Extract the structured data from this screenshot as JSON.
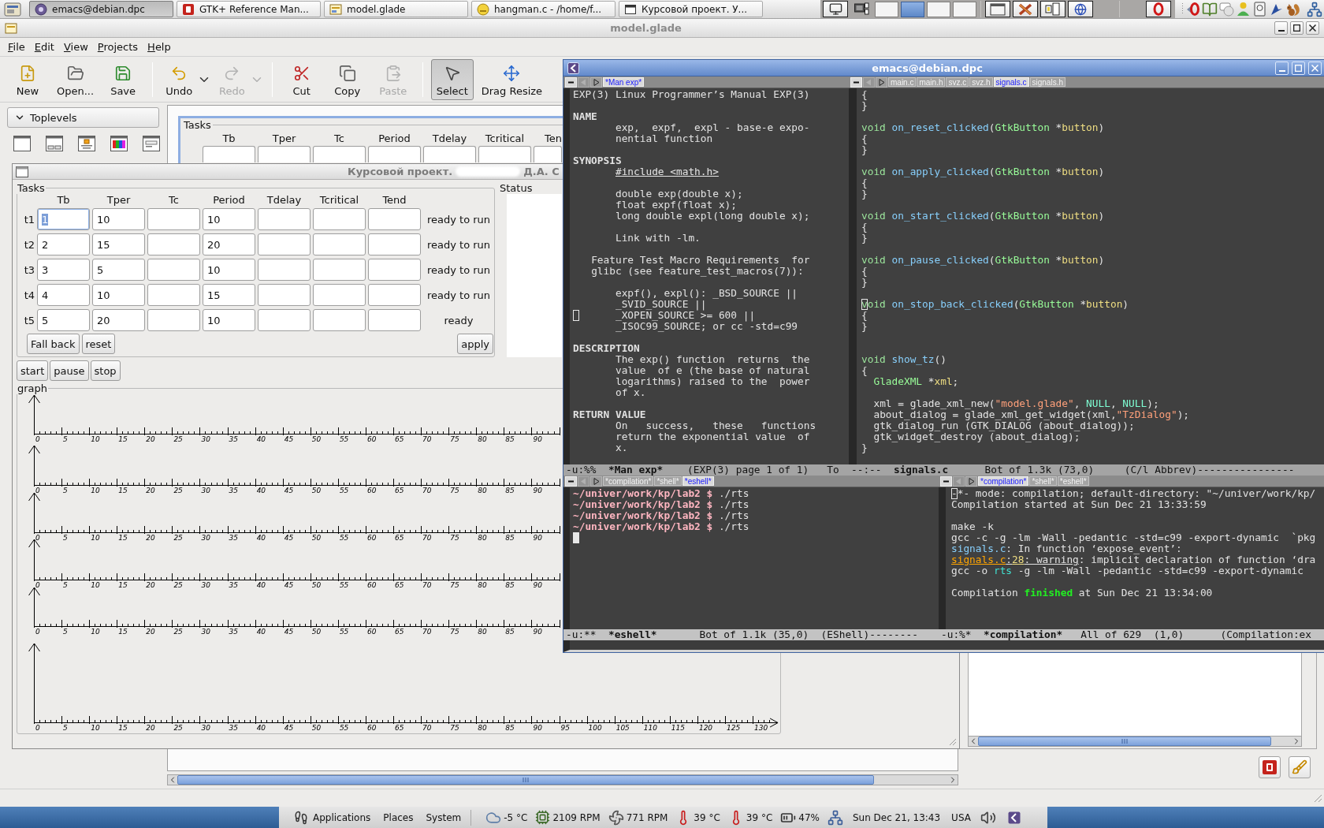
{
  "top_panel": {
    "tasks": [
      {
        "kind": "app",
        "label": "emacs@debian.dpc",
        "selected": true
      },
      {
        "kind": "book",
        "label": "GTK+ Reference Man...",
        "selected": false
      },
      {
        "kind": "designer",
        "label": "model.glade",
        "selected": false
      },
      {
        "kind": "editor",
        "label": "hangman.c - /home/f...",
        "selected": false
      },
      {
        "kind": "window",
        "label": "Курсовой проект. У...",
        "selected": false
      }
    ],
    "workspaces": [
      {
        "selected": false
      },
      {
        "selected": true
      },
      {
        "selected": false
      },
      {
        "selected": false
      }
    ]
  },
  "glade": {
    "title": "model.glade",
    "menu": [
      "File",
      "Edit",
      "View",
      "Projects",
      "Help"
    ],
    "toolbar": [
      [
        {
          "kind": "new",
          "label": "New",
          "disabled": false,
          "selected": false,
          "dropdown": false
        },
        {
          "kind": "open",
          "label": "Open...",
          "disabled": false,
          "selected": false,
          "dropdown": false
        },
        {
          "kind": "save",
          "label": "Save",
          "disabled": false,
          "selected": false,
          "dropdown": false
        }
      ],
      [
        {
          "kind": "undo",
          "label": "Undo",
          "disabled": false,
          "selected": false,
          "dropdown": true
        },
        {
          "kind": "redo",
          "label": "Redo",
          "disabled": true,
          "selected": false,
          "dropdown": true
        }
      ],
      [
        {
          "kind": "cut",
          "label": "Cut",
          "disabled": false,
          "selected": false,
          "dropdown": false
        },
        {
          "kind": "copy",
          "label": "Copy",
          "disabled": false,
          "selected": false,
          "dropdown": false
        },
        {
          "kind": "paste",
          "label": "Paste",
          "disabled": true,
          "selected": false,
          "dropdown": false
        }
      ],
      [
        {
          "kind": "select",
          "label": "Select",
          "disabled": false,
          "selected": true,
          "dropdown": false
        },
        {
          "kind": "drag_resize",
          "label": "Drag Resize",
          "disabled": false,
          "selected": false,
          "dropdown": false
        }
      ]
    ],
    "palette": {
      "group": "Toplevels",
      "expanded": true
    },
    "design_preview": {
      "frame_title": "Tasks",
      "columns": [
        "Tb",
        "Tper",
        "Tc",
        "Period",
        "Tdelay",
        "Tcritical",
        "Ten"
      ]
    }
  },
  "dialog": {
    "title": "Курсовой проект.",
    "title_tail": "Д.А. С",
    "tasks": {
      "title": "Tasks",
      "columns": [
        "Tb",
        "Tper",
        "Tc",
        "Period",
        "Tdelay",
        "Tcritical",
        "Tend"
      ],
      "rows": [
        {
          "label": "t1",
          "cells": [
            {
              "value": "1",
              "selected": true
            },
            {
              "value": "10",
              "selected": false
            },
            {
              "selected": false
            },
            {
              "value": "10",
              "selected": false
            },
            {
              "selected": false
            },
            {
              "selected": false
            },
            {
              "selected": false
            }
          ],
          "status": "ready to run"
        },
        {
          "label": "t2",
          "cells": [
            {
              "value": "2",
              "selected": false
            },
            {
              "value": "15",
              "selected": false
            },
            {
              "selected": false
            },
            {
              "value": "20",
              "selected": false
            },
            {
              "selected": false
            },
            {
              "selected": false
            },
            {
              "selected": false
            }
          ],
          "status": "ready to run"
        },
        {
          "label": "t3",
          "cells": [
            {
              "value": "3",
              "selected": false
            },
            {
              "value": "5",
              "selected": false
            },
            {
              "selected": false
            },
            {
              "value": "10",
              "selected": false
            },
            {
              "selected": false
            },
            {
              "selected": false
            },
            {
              "selected": false
            }
          ],
          "status": "ready to run"
        },
        {
          "label": "t4",
          "cells": [
            {
              "value": "4",
              "selected": false
            },
            {
              "value": "10",
              "selected": false
            },
            {
              "selected": false
            },
            {
              "value": "15",
              "selected": false
            },
            {
              "selected": false
            },
            {
              "selected": false
            },
            {
              "selected": false
            }
          ],
          "status": "ready to run"
        },
        {
          "label": "t5",
          "cells": [
            {
              "value": "5",
              "selected": false
            },
            {
              "value": "20",
              "selected": false
            },
            {
              "selected": false
            },
            {
              "value": "10",
              "selected": false
            },
            {
              "selected": false
            },
            {
              "selected": false
            },
            {
              "selected": false
            }
          ],
          "status": "ready"
        }
      ],
      "buttons": [
        "Fall back",
        "reset"
      ],
      "apply": "apply"
    },
    "status_label": "Status",
    "controls": [
      "start",
      "pause",
      "stop"
    ],
    "graph": {
      "title": "graph",
      "axes": [
        {
          "arrow": false,
          "tick_labels": [
            "0",
            "5",
            "10",
            "15",
            "20",
            "25",
            "30",
            "35",
            "40",
            "45",
            "50",
            "55",
            "60",
            "65",
            "70",
            "75",
            "80",
            "85",
            "90"
          ]
        },
        {
          "arrow": false,
          "tick_labels": [
            "0",
            "5",
            "10",
            "15",
            "20",
            "25",
            "30",
            "35",
            "40",
            "45",
            "50",
            "55",
            "60",
            "65",
            "70",
            "75",
            "80",
            "85",
            "90"
          ]
        },
        {
          "arrow": false,
          "tick_labels": [
            "0",
            "5",
            "10",
            "15",
            "20",
            "25",
            "30",
            "35",
            "40",
            "45",
            "50",
            "55",
            "60",
            "65",
            "70",
            "75",
            "80",
            "85",
            "90"
          ]
        },
        {
          "arrow": false,
          "tick_labels": [
            "0",
            "5",
            "10",
            "15",
            "20",
            "25",
            "30",
            "35",
            "40",
            "45",
            "50",
            "55",
            "60",
            "65",
            "70",
            "75",
            "80",
            "85",
            "90"
          ]
        },
        {
          "arrow": false,
          "tick_labels": [
            "0",
            "5",
            "10",
            "15",
            "20",
            "25",
            "30",
            "35",
            "40",
            "45",
            "50",
            "55",
            "60",
            "65",
            "70",
            "75",
            "80",
            "85",
            "90"
          ]
        },
        {
          "arrow": true,
          "tick_labels": [
            "0",
            "5",
            "10",
            "15",
            "20",
            "25",
            "30",
            "35",
            "40",
            "45",
            "50",
            "55",
            "60",
            "65",
            "70",
            "75",
            "80",
            "85",
            "90",
            "95",
            "100",
            "105",
            "110",
            "115",
            "120",
            "125",
            "130"
          ]
        }
      ]
    }
  },
  "emacs": {
    "title": "emacs@debian.dpc",
    "man_page_window": {
      "active": false,
      "tabs": [
        {
          "label": "*Man exp*",
          "selected": true
        }
      ],
      "lines": [
        {
          "kind": "text",
          "text": "EXP(3) Linux Programmer’s Manual EXP(3)"
        },
        {
          "kind": "blank"
        },
        {
          "kind": "heading",
          "text": "NAME"
        },
        {
          "kind": "text",
          "text": "       exp,  expf,  expl - base-e expo-"
        },
        {
          "kind": "text",
          "text": "       nential function"
        },
        {
          "kind": "blank"
        },
        {
          "kind": "heading",
          "text": "SYNOPSIS"
        },
        {
          "kind": "include",
          "text": "       #include <math.h>"
        },
        {
          "kind": "blank"
        },
        {
          "kind": "text",
          "text": "       double exp(double x);"
        },
        {
          "kind": "text",
          "text": "       float expf(float x);"
        },
        {
          "kind": "text",
          "text": "       long double expl(long double x);"
        },
        {
          "kind": "blank"
        },
        {
          "kind": "text",
          "text": "       Link with -lm."
        },
        {
          "kind": "blank"
        },
        {
          "kind": "text",
          "text": "   Feature Test Macro Requirements  for"
        },
        {
          "kind": "text",
          "text": "   glibc (see feature_test_macros(7)):"
        },
        {
          "kind": "blank"
        },
        {
          "kind": "text",
          "text": "       expf(), expl(): _BSD_SOURCE ||"
        },
        {
          "kind": "text",
          "text": "       _SVID_SOURCE ||"
        },
        {
          "kind": "text",
          "text": "       _XOPEN_SOURCE >= 600 ||",
          "cursor": true
        },
        {
          "kind": "text",
          "text": "       _ISOC99_SOURCE; or cc -std=c99"
        },
        {
          "kind": "blank"
        },
        {
          "kind": "heading",
          "text": "DESCRIPTION"
        },
        {
          "kind": "text",
          "text": "       The exp() function  returns  the"
        },
        {
          "kind": "text",
          "text": "       value  of e (the base of natural"
        },
        {
          "kind": "text",
          "text": "       logarithms) raised to the  power"
        },
        {
          "kind": "text",
          "text": "       of x."
        },
        {
          "kind": "blank"
        },
        {
          "kind": "heading",
          "text": "RETURN VALUE"
        },
        {
          "kind": "text",
          "text": "       On   success,   these   functions"
        },
        {
          "kind": "text",
          "text": "       return the exponential value  of"
        },
        {
          "kind": "text",
          "text": "       x."
        }
      ],
      "mode_line": [
        {
          "kind": "plain",
          "text": "-u:%%  "
        },
        {
          "kind": "buffer",
          "text": "*Man exp*"
        },
        {
          "kind": "plain",
          "text": "    (EXP(3) page 1 of 1)   To"
        }
      ]
    },
    "source_window": {
      "active": false,
      "tabs": [
        {
          "label": "main.c",
          "selected": false
        },
        {
          "label": "main.h",
          "selected": false
        },
        {
          "label": "svz.c",
          "selected": false
        },
        {
          "label": "svz.h",
          "selected": false
        },
        {
          "label": "signals.c",
          "selected": true
        },
        {
          "label": "signals.h",
          "selected": false
        }
      ],
      "lines": [
        {
          "kind": "text",
          "text": "{"
        },
        {
          "kind": "text",
          "text": "}"
        },
        {
          "kind": "blank"
        },
        {
          "kind": "code",
          "segments": [
            {
              "kind": "keyword",
              "text": "void "
            },
            {
              "kind": "function",
              "text": "on_reset_clicked"
            },
            {
              "kind": "plain",
              "text": "("
            },
            {
              "kind": "type",
              "text": "GtkButton"
            },
            {
              "kind": "plain",
              "text": " *"
            },
            {
              "kind": "variable",
              "text": "button"
            },
            {
              "kind": "plain",
              "text": ")"
            }
          ]
        },
        {
          "kind": "text",
          "text": "{"
        },
        {
          "kind": "text",
          "text": "}"
        },
        {
          "kind": "blank"
        },
        {
          "kind": "code",
          "segments": [
            {
              "kind": "keyword",
              "text": "void "
            },
            {
              "kind": "function",
              "text": "on_apply_clicked"
            },
            {
              "kind": "plain",
              "text": "("
            },
            {
              "kind": "type",
              "text": "GtkButton"
            },
            {
              "kind": "plain",
              "text": " *"
            },
            {
              "kind": "variable",
              "text": "button"
            },
            {
              "kind": "plain",
              "text": ")"
            }
          ]
        },
        {
          "kind": "text",
          "text": "{"
        },
        {
          "kind": "text",
          "text": "}"
        },
        {
          "kind": "blank"
        },
        {
          "kind": "code",
          "segments": [
            {
              "kind": "keyword",
              "text": "void "
            },
            {
              "kind": "function",
              "text": "on_start_clicked"
            },
            {
              "kind": "plain",
              "text": "("
            },
            {
              "kind": "type",
              "text": "GtkButton"
            },
            {
              "kind": "plain",
              "text": " *"
            },
            {
              "kind": "variable",
              "text": "button"
            },
            {
              "kind": "plain",
              "text": ")"
            }
          ]
        },
        {
          "kind": "text",
          "text": "{"
        },
        {
          "kind": "text",
          "text": "}"
        },
        {
          "kind": "blank"
        },
        {
          "kind": "code",
          "segments": [
            {
              "kind": "keyword",
              "text": "void "
            },
            {
              "kind": "function",
              "text": "on_pause_clicked"
            },
            {
              "kind": "plain",
              "text": "("
            },
            {
              "kind": "type",
              "text": "GtkButton"
            },
            {
              "kind": "plain",
              "text": " *"
            },
            {
              "kind": "variable",
              "text": "button"
            },
            {
              "kind": "plain",
              "text": ")"
            }
          ]
        },
        {
          "kind": "text",
          "text": "{"
        },
        {
          "kind": "text",
          "text": "}"
        },
        {
          "kind": "blank"
        },
        {
          "kind": "code",
          "cursor": true,
          "segments": [
            {
              "kind": "keyword",
              "text": "void "
            },
            {
              "kind": "function",
              "text": "on_stop_back_clicked"
            },
            {
              "kind": "plain",
              "text": "("
            },
            {
              "kind": "type",
              "text": "GtkButton"
            },
            {
              "kind": "plain",
              "text": " *"
            },
            {
              "kind": "variable",
              "text": "button"
            },
            {
              "kind": "plain",
              "text": ")"
            }
          ]
        },
        {
          "kind": "text",
          "text": "{"
        },
        {
          "kind": "text",
          "text": "}"
        },
        {
          "kind": "blank"
        },
        {
          "kind": "blank"
        },
        {
          "kind": "code",
          "segments": [
            {
              "kind": "keyword",
              "text": "void "
            },
            {
              "kind": "function",
              "text": "show_tz"
            },
            {
              "kind": "plain",
              "text": "()"
            }
          ]
        },
        {
          "kind": "text",
          "text": "{"
        },
        {
          "kind": "code",
          "segments": [
            {
              "kind": "type",
              "text": "  GladeXML"
            },
            {
              "kind": "plain",
              "text": " *"
            },
            {
              "kind": "variable",
              "text": "xml"
            },
            {
              "kind": "plain",
              "text": ";"
            }
          ]
        },
        {
          "kind": "blank"
        },
        {
          "kind": "code",
          "segments": [
            {
              "kind": "plain",
              "text": "  xml = glade_xml_new("
            },
            {
              "kind": "string",
              "text": "\"model.glade\""
            },
            {
              "kind": "plain",
              "text": ", "
            },
            {
              "kind": "constant",
              "text": "NULL"
            },
            {
              "kind": "plain",
              "text": ", "
            },
            {
              "kind": "constant",
              "text": "NULL"
            },
            {
              "kind": "plain",
              "text": ");"
            }
          ]
        },
        {
          "kind": "code",
          "segments": [
            {
              "kind": "plain",
              "text": "  about_dialog = glade_xml_get_widget(xml,"
            },
            {
              "kind": "string",
              "text": "\"TzDialog\""
            },
            {
              "kind": "plain",
              "text": ");"
            }
          ]
        },
        {
          "kind": "text",
          "text": "  gtk_dialog_run (GTK_DIALOG (about_dialog));"
        },
        {
          "kind": "text",
          "text": "  gtk_widget_destroy (about_dialog);"
        },
        {
          "kind": "text",
          "text": "}"
        }
      ],
      "mode_line": [
        {
          "kind": "plain",
          "text": "--:--  "
        },
        {
          "kind": "buffer",
          "text": "signals.c"
        },
        {
          "kind": "plain",
          "text": "      Bot of 1.3k (73,0)     (C/l Abbrev)----------------"
        }
      ]
    },
    "eshell_window": {
      "active": true,
      "tabs": [
        {
          "label": "*compilation*",
          "selected": false
        },
        {
          "label": "*shell*",
          "selected": false
        },
        {
          "label": "*eshell*",
          "selected": true
        }
      ],
      "lines": [
        {
          "kind": "code",
          "segments": [
            {
              "kind": "prompt",
              "text": "~/univer/work/kp/lab2 $"
            },
            {
              "kind": "plain",
              "text": " ./rts"
            }
          ]
        },
        {
          "kind": "code",
          "segments": [
            {
              "kind": "prompt",
              "text": "~/univer/work/kp/lab2 $"
            },
            {
              "kind": "plain",
              "text": " ./rts"
            }
          ]
        },
        {
          "kind": "code",
          "segments": [
            {
              "kind": "prompt",
              "text": "~/univer/work/kp/lab2 $"
            },
            {
              "kind": "plain",
              "text": " ./rts"
            }
          ]
        },
        {
          "kind": "code",
          "segments": [
            {
              "kind": "prompt",
              "text": "~/univer/work/kp/lab2 $"
            },
            {
              "kind": "plain",
              "text": " ./rts"
            }
          ]
        },
        {
          "kind": "blank",
          "cursor": true
        }
      ],
      "mode_line": [
        {
          "kind": "plain",
          "text": "-u:**  "
        },
        {
          "kind": "buffer",
          "text": "*eshell*"
        },
        {
          "kind": "plain",
          "text": "       Bot of 1.1k (35,0)  (EShell)--------"
        }
      ]
    },
    "compilation_window": {
      "active": false,
      "tabs": [
        {
          "label": "*compilation*",
          "selected": true
        },
        {
          "label": "*shell*",
          "selected": false
        },
        {
          "label": "*eshell*",
          "selected": false
        }
      ],
      "lines": [
        {
          "kind": "text",
          "cursor": true,
          "text": "-*- mode: compilation; default-directory: \"~/univer/work/kp/"
        },
        {
          "kind": "text",
          "text": "Compilation started at Sun Dec 21 13:33:59"
        },
        {
          "kind": "blank"
        },
        {
          "kind": "text",
          "text": "make -k"
        },
        {
          "kind": "text",
          "text": "gcc -c -g -lm -Wall -pedantic -std=c99 -export-dynamic  `pkg"
        },
        {
          "kind": "code",
          "segments": [
            {
              "kind": "file",
              "text": "signals.c"
            },
            {
              "kind": "plain",
              "text": ": In function ‘expose_event’:"
            }
          ]
        },
        {
          "kind": "code",
          "segments": [
            {
              "kind": "error_file",
              "text": "signals.c"
            },
            {
              "kind": "link",
              "text": ":"
            },
            {
              "kind": "line_number",
              "text": "28"
            },
            {
              "kind": "link",
              "text": ": warning"
            },
            {
              "kind": "plain",
              "text": ": implicit declaration of function ‘dra"
            }
          ]
        },
        {
          "kind": "code",
          "segments": [
            {
              "kind": "plain",
              "text": "gcc -o "
            },
            {
              "kind": "program",
              "text": "rts"
            },
            {
              "kind": "plain",
              "text": " -g -lm -Wall -pedantic -std=c99 -export-dynamic"
            }
          ]
        },
        {
          "kind": "blank"
        },
        {
          "kind": "code",
          "segments": [
            {
              "kind": "plain",
              "text": "Compilation "
            },
            {
              "kind": "success",
              "text": "finished"
            },
            {
              "kind": "plain",
              "text": " at Sun Dec 21 13:34:00"
            }
          ]
        }
      ],
      "mode_line": [
        {
          "kind": "plain",
          "text": "-u:%*  "
        },
        {
          "kind": "buffer",
          "text": "*compilation*"
        },
        {
          "kind": "plain",
          "text": "   All of 629  (1,0)      (Compilation:ex"
        }
      ]
    }
  },
  "bottom_panel": {
    "menus": [
      "Applications",
      "Places",
      "System"
    ],
    "readings": [
      {
        "kind": "weather",
        "text": "-5 °C"
      },
      {
        "kind": "chip",
        "text": "2109 RPM"
      },
      {
        "kind": "fan",
        "text": "771 RPM"
      },
      {
        "kind": "thermometer",
        "text": "39 °C"
      },
      {
        "kind": "thermometer",
        "text": "39 °C"
      },
      {
        "kind": "battery",
        "text": "47%"
      }
    ],
    "clock": "Sun Dec 21, 13:43",
    "keyboard": "USA"
  }
}
